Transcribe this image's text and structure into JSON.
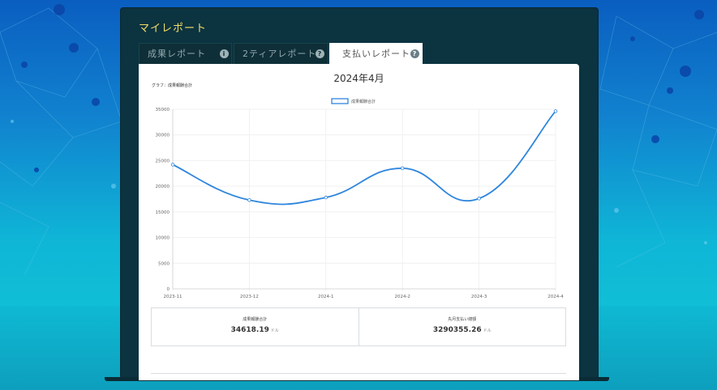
{
  "page": {
    "title": "マイレポート"
  },
  "tabs": [
    {
      "label": "成果レポート",
      "active": false,
      "icon": "info-icon"
    },
    {
      "label": "2ティアレポート",
      "active": false,
      "icon": "info-icon"
    },
    {
      "label": "支払いレポート",
      "active": true,
      "icon": "info-icon"
    }
  ],
  "report": {
    "month": "2024年4月",
    "graph_label": "グラフ：成果報酬合計"
  },
  "chart_data": {
    "type": "line",
    "categories": [
      "2023-11",
      "2023-12",
      "2024-1",
      "2024-2",
      "2024-3",
      "2024-4"
    ],
    "series": [
      {
        "name": "成果報酬合計",
        "values": [
          24200,
          17300,
          17800,
          23500,
          17600,
          34618.19
        ],
        "color": "#2e86de"
      }
    ],
    "yticks": [
      0,
      5000,
      10000,
      15000,
      20000,
      25000,
      30000,
      35000
    ],
    "ylim": [
      0,
      35000
    ],
    "grid": true,
    "legend": "top-center"
  },
  "summary": [
    {
      "label": "成果報酬合計",
      "value": "34618.19",
      "unit": "ドル"
    },
    {
      "label": "先月支払い總額",
      "value": "3290355.26",
      "unit": "ドル"
    }
  ]
}
